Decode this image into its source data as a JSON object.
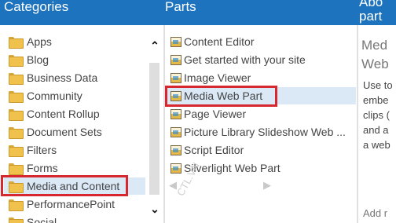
{
  "header": {
    "categories_title": "Categories",
    "parts_title": "Parts",
    "about_title_line1": "Abo",
    "about_title_line2": "part"
  },
  "categories": {
    "items": [
      {
        "label": "Apps"
      },
      {
        "label": "Blog"
      },
      {
        "label": "Business Data"
      },
      {
        "label": "Community"
      },
      {
        "label": "Content Rollup"
      },
      {
        "label": "Document Sets"
      },
      {
        "label": "Filters"
      },
      {
        "label": "Forms"
      },
      {
        "label": "Media and Content",
        "selected": true
      },
      {
        "label": "PerformancePoint"
      },
      {
        "label": "Social"
      }
    ],
    "scroll_up_icon": "chevron-up-icon",
    "scroll_down_icon": "chevron-down-icon"
  },
  "parts": {
    "items": [
      {
        "label": "Content Editor"
      },
      {
        "label": "Get started with your site"
      },
      {
        "label": "Image Viewer"
      },
      {
        "label": "Media Web Part",
        "selected": true
      },
      {
        "label": "Page Viewer"
      },
      {
        "label": "Picture Library Slideshow Web ..."
      },
      {
        "label": "Script Editor"
      },
      {
        "label": "Silverlight Web Part"
      }
    ],
    "nav_left_icon": "arrow-left-icon",
    "nav_right_icon": "arrow-right-icon",
    "watermark": "CTL.VN"
  },
  "about": {
    "title_line1": "Med",
    "title_line2": "Web",
    "desc_lines": [
      "Use to",
      "embe",
      "clips (",
      "and a",
      "a web"
    ],
    "add_link": "Add r"
  },
  "colors": {
    "header_bg": "#1e73be",
    "selection_bg": "#dbe8f6",
    "highlight_border": "#d8282f"
  }
}
